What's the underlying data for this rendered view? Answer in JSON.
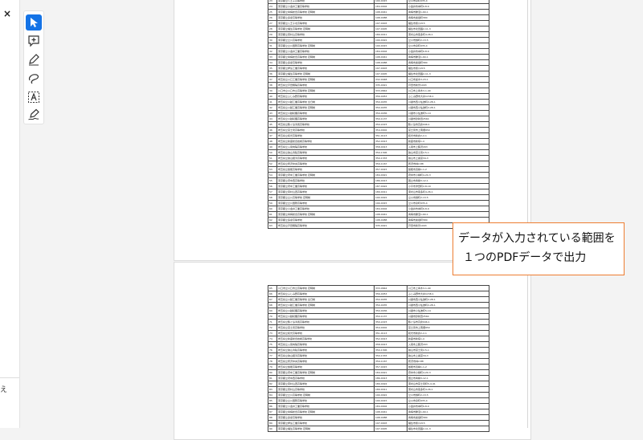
{
  "side_panel": {
    "close_glyph": "×",
    "bottom_text": "え"
  },
  "tools": [
    {
      "name": "select-tool",
      "icon": "cursor-arrow-icon",
      "active": true
    },
    {
      "name": "comment-tool",
      "icon": "add-comment-icon",
      "active": false
    },
    {
      "name": "highlight-pen-tool",
      "icon": "pen-icon",
      "active": false
    },
    {
      "name": "freehand-draw-tool",
      "icon": "lasso-draw-icon",
      "active": false
    },
    {
      "name": "text-box-tool",
      "icon": "text-box-icon",
      "active": false
    },
    {
      "name": "sign-tool",
      "icon": "signature-pen-icon",
      "active": false
    }
  ],
  "callout": {
    "line1": "データが入力されている範囲を",
    "line2": "１つのPDFデータで出力"
  },
  "sheet_top": [
    [
      "23",
      "東京都立八王子高等学校",
      "190-0015",
      "立川市泉町935-4"
    ],
    [
      "24",
      "東京都立小金井工業高等学校",
      "184-0004",
      "小金井市本町6-8-9"
    ],
    [
      "25",
      "東京都立青梅総合高等学校 定時制",
      "198-0041",
      "青梅市勝沼1-60-1"
    ],
    [
      "26",
      "東京都立多摩高等学校",
      "198-0088",
      "青梅市裏宿町580"
    ],
    [
      "27",
      "東京都立八王子北高等学校",
      "197-0003",
      "福生市熊川215"
    ],
    [
      "28",
      "東京都立福生高等学校 定時制",
      "197-0005",
      "福生市北田園2-11-3"
    ],
    [
      "29",
      "東京都立東村山高等学校",
      "189-0011",
      "東村山市恩多町4-26-1"
    ],
    [
      "30",
      "東京都立立川高等学校",
      "190-0022",
      "立川市錦町2-13-5"
    ],
    [
      "31",
      "東京都立立川国際高等学校 定時制",
      "190-0015",
      "立川市泉町935-4"
    ],
    [
      "32",
      "東京都立小金井工業高等学校",
      "184-0004",
      "小金井市本町6-8-9"
    ],
    [
      "33",
      "東京都立青梅総合高等学校 定時制",
      "198-0041",
      "青梅市勝沼1-60-1"
    ],
    [
      "34",
      "東京都立多摩高等学校",
      "198-0088",
      "青梅市裏宿町580"
    ],
    [
      "35",
      "東京都立拝島工業高等学校",
      "197-0003",
      "福生市熊川215"
    ],
    [
      "36",
      "東京都立福生高等学校 定時制",
      "197-0005",
      "福生市北田園2-11-3"
    ],
    [
      "37",
      "埼玉県立川口工業高等学校 定時制",
      "332-0048",
      "川口市並木3-23-1"
    ],
    [
      "38",
      "埼玉県立戸田翔陽高等学校",
      "335-0021",
      "戸田市新曽1093"
    ],
    [
      "39",
      "川口市立川口市立高等学校 定時制",
      "333-0844",
      "川口市上青木3-1-40"
    ],
    [
      "40",
      "埼玉県立ふじみ野高等学校",
      "356-0053",
      "ふじみ野市大井1158-1"
    ],
    [
      "41",
      "埼玉県立川越工業高等学校 全日制",
      "350-0035",
      "川越市西小仙波町2-28-1"
    ],
    [
      "42",
      "埼玉県立川越工業高等学校 定時制",
      "350-0035",
      "川越市西小仙波町2-28-1"
    ],
    [
      "43",
      "埼玉県立川越初雁高等学校",
      "350-0036",
      "川越市小仙波町5-14"
    ],
    [
      "44",
      "埼玉県立川越初雁高等学校",
      "350-1137",
      "川越市砂新田2564"
    ],
    [
      "45",
      "埼玉県立鶴ヶ島清風高等学校",
      "350-2223",
      "鶴ヶ島市高倉946-1"
    ],
    [
      "46",
      "埼玉県立富士見高等学校",
      "354-0002",
      "富士見市上南畑950"
    ],
    [
      "47",
      "埼玉県立和光高等学校",
      "351-0113",
      "和光市新倉2-2-1"
    ],
    [
      "48",
      "埼玉県立新座総合技術高等学校",
      "352-0013",
      "新座市新塚1-4"
    ],
    [
      "49",
      "埼玉県立入間向陽高等学校",
      "358-0013",
      "入間市上藤沢293"
    ],
    [
      "50",
      "埼玉県立狭山清陵高等学校",
      "350-1306",
      "狭山市富士見2-5-1"
    ],
    [
      "51",
      "埼玉県立狭山経済高等学校",
      "350-1333",
      "狭山市上奥富34-3"
    ],
    [
      "52",
      "埼玉県立所沢中央高等学校",
      "359-1167",
      "所沢市林2-88"
    ],
    [
      "53",
      "埼玉県立飯能高等学校",
      "357-0015",
      "飯能市双柳1-1-2"
    ],
    [
      "54",
      "東京都立府中工業高等学校 定時制",
      "184-0021",
      "府中市小柳町4-20-3"
    ],
    [
      "55",
      "東京都立府中西高等学校",
      "186-0013",
      "国立市青柳3-12-1"
    ],
    [
      "56",
      "東京都立府中工業高等学校",
      "187-0024",
      "小平市津田町2-8-19"
    ],
    [
      "57",
      "東京都立東村山西高等学校",
      "189-0011",
      "東村山市恩多町4-26-1"
    ],
    [
      "58",
      "東京都立立川高等学校 定時制",
      "190-0022",
      "立川市錦町2-13-5"
    ],
    [
      "59",
      "東京都立立川国際高等学校",
      "190-0015",
      "立川市泉町935-4"
    ],
    [
      "60",
      "東京都立小金井工業高等学校",
      "184-0004",
      "小金井市本町6-8-9"
    ],
    [
      "61",
      "東京都立青梅総合高等学校 定時制",
      "198-0041",
      "青梅市勝沼1-60-1"
    ],
    [
      "62",
      "東京都立多摩高等学校",
      "198-0088",
      "青梅市裏宿町580"
    ],
    [
      "63",
      "埼玉県立戸田翔陽高等学校",
      "335-0021",
      "戸田市新曽1093"
    ]
  ],
  "sheet_bottom": [
    [
      "65",
      "川口市立川口市立高等学校 定時制",
      "333-0844",
      "川口市上青木3-1-40"
    ],
    [
      "66",
      "埼玉県立ふじみ野高等学校",
      "356-0053",
      "ふじみ野市大井1158-1"
    ],
    [
      "67",
      "埼玉県立川越工業高等学校 全日制",
      "350-0035",
      "川越市西小仙波町2-28-1"
    ],
    [
      "68",
      "埼玉県立川越工業高等学校 定時制",
      "350-0035",
      "川越市西小仙波町2-28-1"
    ],
    [
      "69",
      "埼玉県立川越初雁高等学校",
      "350-0036",
      "川越市小仙波町5-14"
    ],
    [
      "70",
      "埼玉県立川越初雁高等学校",
      "350-1137",
      "川越市砂新田2564"
    ],
    [
      "71",
      "埼玉県立鶴ヶ島清風高等学校",
      "350-2223",
      "鶴ヶ島市高倉946-1"
    ],
    [
      "72",
      "埼玉県立富士見高等学校",
      "354-0002",
      "富士見市上南畑950"
    ],
    [
      "73",
      "埼玉県立和光高等学校",
      "351-0113",
      "和光市新倉2-2-1"
    ],
    [
      "74",
      "埼玉県立新座総合技術高等学校",
      "352-0013",
      "新座市新塚1-4"
    ],
    [
      "75",
      "埼玉県立入間向陽高等学校",
      "358-0013",
      "入間市上藤沢293"
    ],
    [
      "76",
      "埼玉県立狭山清陵高等学校",
      "350-1306",
      "狭山市富士見2-5-1"
    ],
    [
      "77",
      "埼玉県立狭山経済高等学校",
      "350-1333",
      "狭山市上奥富34-3"
    ],
    [
      "78",
      "埼玉県立所沢中央高等学校",
      "359-1167",
      "所沢市林2-88"
    ],
    [
      "79",
      "埼玉県立飯能高等学校",
      "357-0015",
      "飯能市双柳1-1-2"
    ],
    [
      "80",
      "東京都立府中工業高等学校 定時制",
      "184-0021",
      "府中市小柳町4-20-3"
    ],
    [
      "81",
      "東京都立府中西高等学校",
      "186-0013",
      "国立市青柳3-12-1"
    ],
    [
      "82",
      "東京都立東村山西高等学校",
      "189-0024",
      "東村山市富士見町5-4-41"
    ],
    [
      "83",
      "東京都立東村山高等学校",
      "189-0011",
      "東村山市恩多町4-26-1"
    ],
    [
      "84",
      "東京都立立川高等学校 定時制",
      "190-0022",
      "立川市錦町2-13-5"
    ],
    [
      "85",
      "東京都立立川国際高等学校",
      "190-0015",
      "立川市泉町935-4"
    ],
    [
      "86",
      "東京都立小金井工業高等学校",
      "184-0004",
      "小金井市本町6-8-9"
    ],
    [
      "87",
      "東京都立青梅総合高等学校 定時制",
      "198-0041",
      "青梅市勝沼1-60-1"
    ],
    [
      "88",
      "東京都立多摩高等学校",
      "198-0088",
      "青梅市裏宿町580"
    ],
    [
      "89",
      "東京都立拝島工業高等学校",
      "197-0003",
      "福生市熊川215"
    ],
    [
      "90",
      "東京都立福生高等学校 定時制",
      "197-0005",
      "福生市北田園2-11-3"
    ]
  ]
}
